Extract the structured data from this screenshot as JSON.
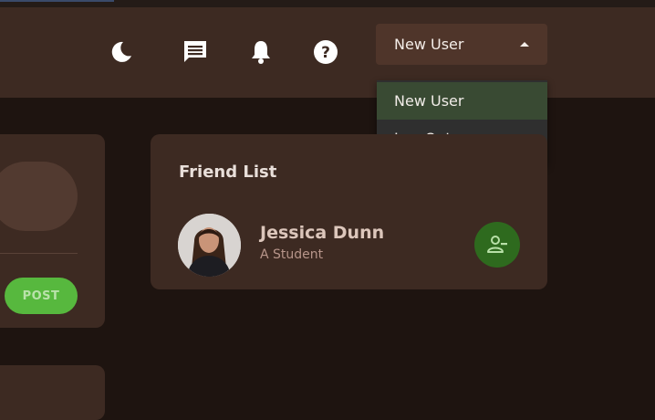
{
  "header": {
    "icons": [
      "moon-icon",
      "chat-icon",
      "bell-icon",
      "help-icon"
    ],
    "user_menu": {
      "label": "New User",
      "items": [
        {
          "label": "New User"
        },
        {
          "label": "Log Out"
        }
      ]
    }
  },
  "post_card": {
    "post_label": "POST"
  },
  "friend_list": {
    "title": "Friend List",
    "friends": [
      {
        "name": "Jessica Dunn",
        "role": "A Student",
        "action_icon": "remove-friend-icon"
      }
    ]
  },
  "colors": {
    "background": "#1e1410",
    "card": "#3d2a22",
    "accent_green": "#57b83e",
    "dropdown_active": "#394a33"
  }
}
